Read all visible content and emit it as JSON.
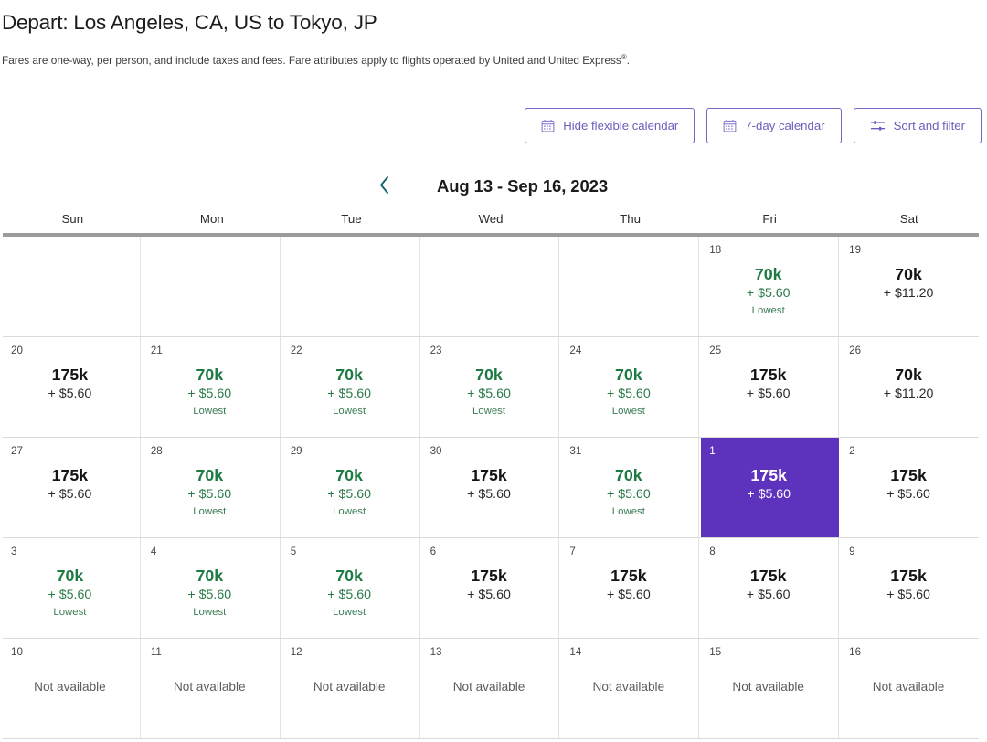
{
  "header": {
    "title": "Depart: Los Angeles, CA, US to Tokyo, JP",
    "subtitle_part1": "Fares are one-way, per person, and include taxes and fees. Fare attributes apply to flights operated by United and United Express",
    "subtitle_sup": "®",
    "subtitle_part2": "."
  },
  "toolbar": {
    "hide_flexible_calendar": "Hide flexible calendar",
    "seven_day_calendar": "7-day calendar",
    "sort_and_filter": "Sort and filter",
    "icons": {
      "hide_flexible_calendar": "calendar-icon",
      "seven_day_calendar": "calendar-icon",
      "sort_and_filter": "sliders-icon"
    },
    "accent_color": "#6a5fbb",
    "border_color": "#7367c6"
  },
  "month_nav": {
    "prev_icon": "chevron-left-icon",
    "range_label": "Aug 13 - Sep 16, 2023",
    "chevron_color": "#15656d"
  },
  "calendar": {
    "day_headers": [
      "Sun",
      "Mon",
      "Tue",
      "Wed",
      "Thu",
      "Fri",
      "Sat"
    ],
    "selected_color": "#5d33bd",
    "lowest_color": "#1d7a42",
    "labels": {
      "lowest": "Lowest",
      "not_available": "Not available"
    },
    "weeks": [
      [
        {
          "empty": true
        },
        {
          "empty": true
        },
        {
          "empty": true
        },
        {
          "empty": true
        },
        {
          "empty": true
        },
        {
          "day": "18",
          "price": "70k",
          "tax": "+ $5.60",
          "lowest": "Lowest",
          "state": "lowest"
        },
        {
          "day": "19",
          "price": "70k",
          "tax": "+ $11.20",
          "lowest": "",
          "state": "normal"
        }
      ],
      [
        {
          "day": "20",
          "price": "175k",
          "tax": "+ $5.60",
          "lowest": "",
          "state": "normal"
        },
        {
          "day": "21",
          "price": "70k",
          "tax": "+ $5.60",
          "lowest": "Lowest",
          "state": "lowest"
        },
        {
          "day": "22",
          "price": "70k",
          "tax": "+ $5.60",
          "lowest": "Lowest",
          "state": "lowest"
        },
        {
          "day": "23",
          "price": "70k",
          "tax": "+ $5.60",
          "lowest": "Lowest",
          "state": "lowest"
        },
        {
          "day": "24",
          "price": "70k",
          "tax": "+ $5.60",
          "lowest": "Lowest",
          "state": "lowest"
        },
        {
          "day": "25",
          "price": "175k",
          "tax": "+ $5.60",
          "lowest": "",
          "state": "normal"
        },
        {
          "day": "26",
          "price": "70k",
          "tax": "+ $11.20",
          "lowest": "",
          "state": "normal"
        }
      ],
      [
        {
          "day": "27",
          "price": "175k",
          "tax": "+ $5.60",
          "lowest": "",
          "state": "normal"
        },
        {
          "day": "28",
          "price": "70k",
          "tax": "+ $5.60",
          "lowest": "Lowest",
          "state": "lowest"
        },
        {
          "day": "29",
          "price": "70k",
          "tax": "+ $5.60",
          "lowest": "Lowest",
          "state": "lowest"
        },
        {
          "day": "30",
          "price": "175k",
          "tax": "+ $5.60",
          "lowest": "",
          "state": "normal"
        },
        {
          "day": "31",
          "price": "70k",
          "tax": "+ $5.60",
          "lowest": "Lowest",
          "state": "lowest"
        },
        {
          "day": "1",
          "price": "175k",
          "tax": "+ $5.60",
          "lowest": "",
          "state": "selected"
        },
        {
          "day": "2",
          "price": "175k",
          "tax": "+ $5.60",
          "lowest": "",
          "state": "normal"
        }
      ],
      [
        {
          "day": "3",
          "price": "70k",
          "tax": "+ $5.60",
          "lowest": "Lowest",
          "state": "lowest"
        },
        {
          "day": "4",
          "price": "70k",
          "tax": "+ $5.60",
          "lowest": "Lowest",
          "state": "lowest"
        },
        {
          "day": "5",
          "price": "70k",
          "tax": "+ $5.60",
          "lowest": "Lowest",
          "state": "lowest"
        },
        {
          "day": "6",
          "price": "175k",
          "tax": "+ $5.60",
          "lowest": "",
          "state": "normal"
        },
        {
          "day": "7",
          "price": "175k",
          "tax": "+ $5.60",
          "lowest": "",
          "state": "normal"
        },
        {
          "day": "8",
          "price": "175k",
          "tax": "+ $5.60",
          "lowest": "",
          "state": "normal"
        },
        {
          "day": "9",
          "price": "175k",
          "tax": "+ $5.60",
          "lowest": "",
          "state": "normal"
        }
      ],
      [
        {
          "day": "10",
          "unavailable": "Not available"
        },
        {
          "day": "11",
          "unavailable": "Not available"
        },
        {
          "day": "12",
          "unavailable": "Not available"
        },
        {
          "day": "13",
          "unavailable": "Not available"
        },
        {
          "day": "14",
          "unavailable": "Not available"
        },
        {
          "day": "15",
          "unavailable": "Not available"
        },
        {
          "day": "16",
          "unavailable": "Not available"
        }
      ]
    ]
  }
}
